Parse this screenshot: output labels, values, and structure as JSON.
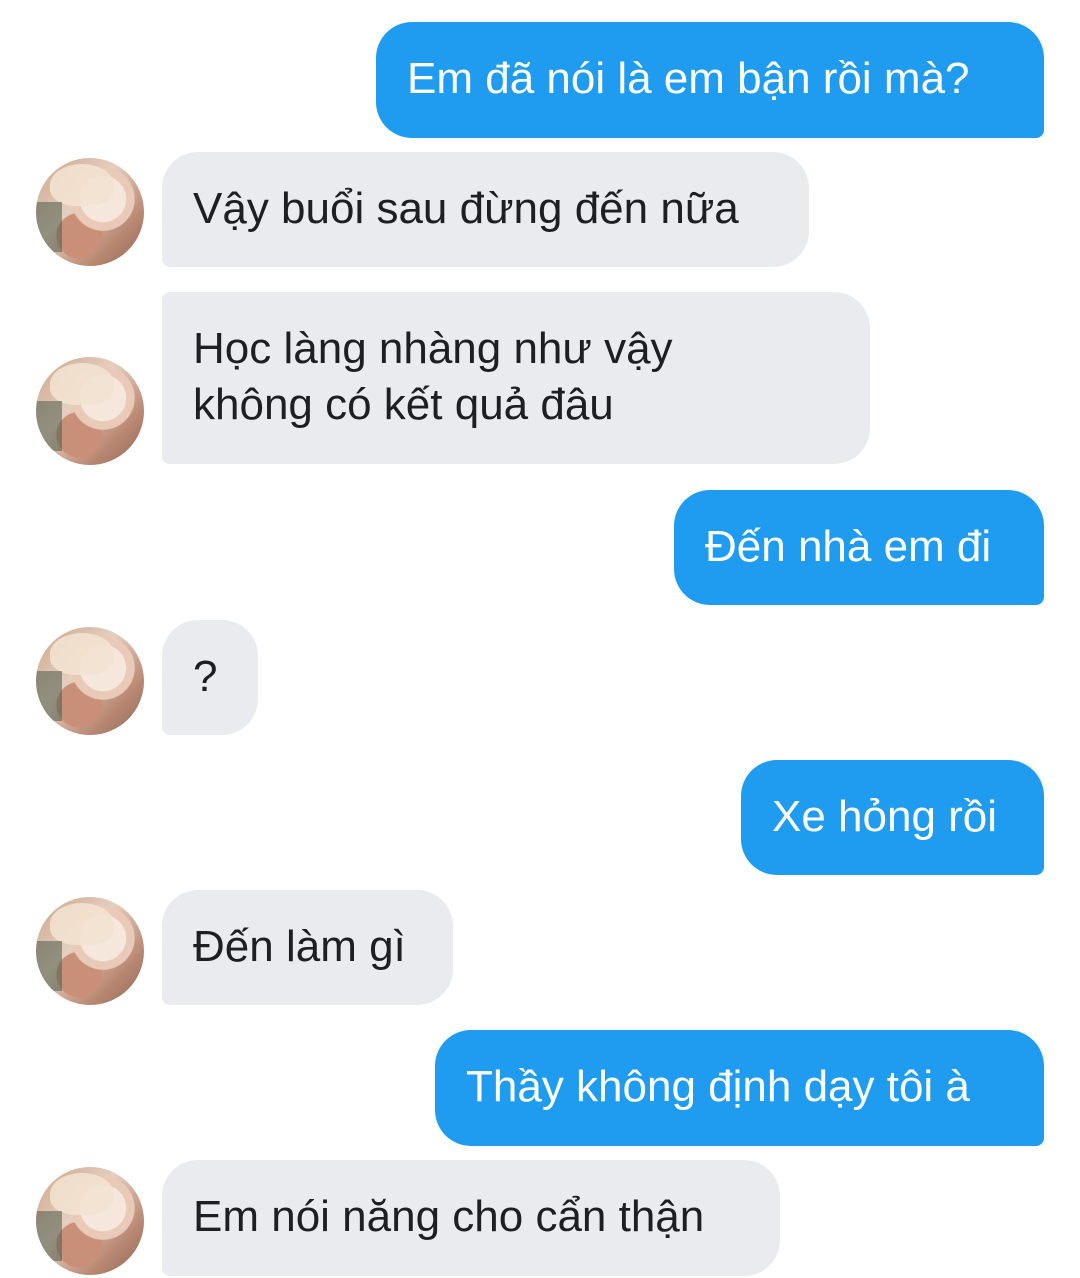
{
  "conversation": {
    "messages": [
      {
        "direction": "outgoing",
        "text": "Em đã nói là em bận rồi mà?"
      },
      {
        "direction": "incoming",
        "text": "Vậy buổi sau đừng đến nữa"
      },
      {
        "direction": "incoming",
        "text": "Học làng nhàng như vậy\nkhông có kết quả đâu"
      },
      {
        "direction": "outgoing",
        "text": "Đến nhà em đi"
      },
      {
        "direction": "incoming",
        "text": "?"
      },
      {
        "direction": "outgoing",
        "text": "Xe hỏng rồi"
      },
      {
        "direction": "incoming",
        "text": "Đến làm gì"
      },
      {
        "direction": "outgoing",
        "text": "Thầy không định dạy tôi à"
      },
      {
        "direction": "incoming",
        "text": "Em nói năng cho cẩn thận"
      }
    ]
  },
  "colors": {
    "outgoing_bubble": "#1f9cf0",
    "incoming_bubble": "#e9ebef",
    "outgoing_text": "#ffffff",
    "incoming_text": "#1d1f22"
  }
}
